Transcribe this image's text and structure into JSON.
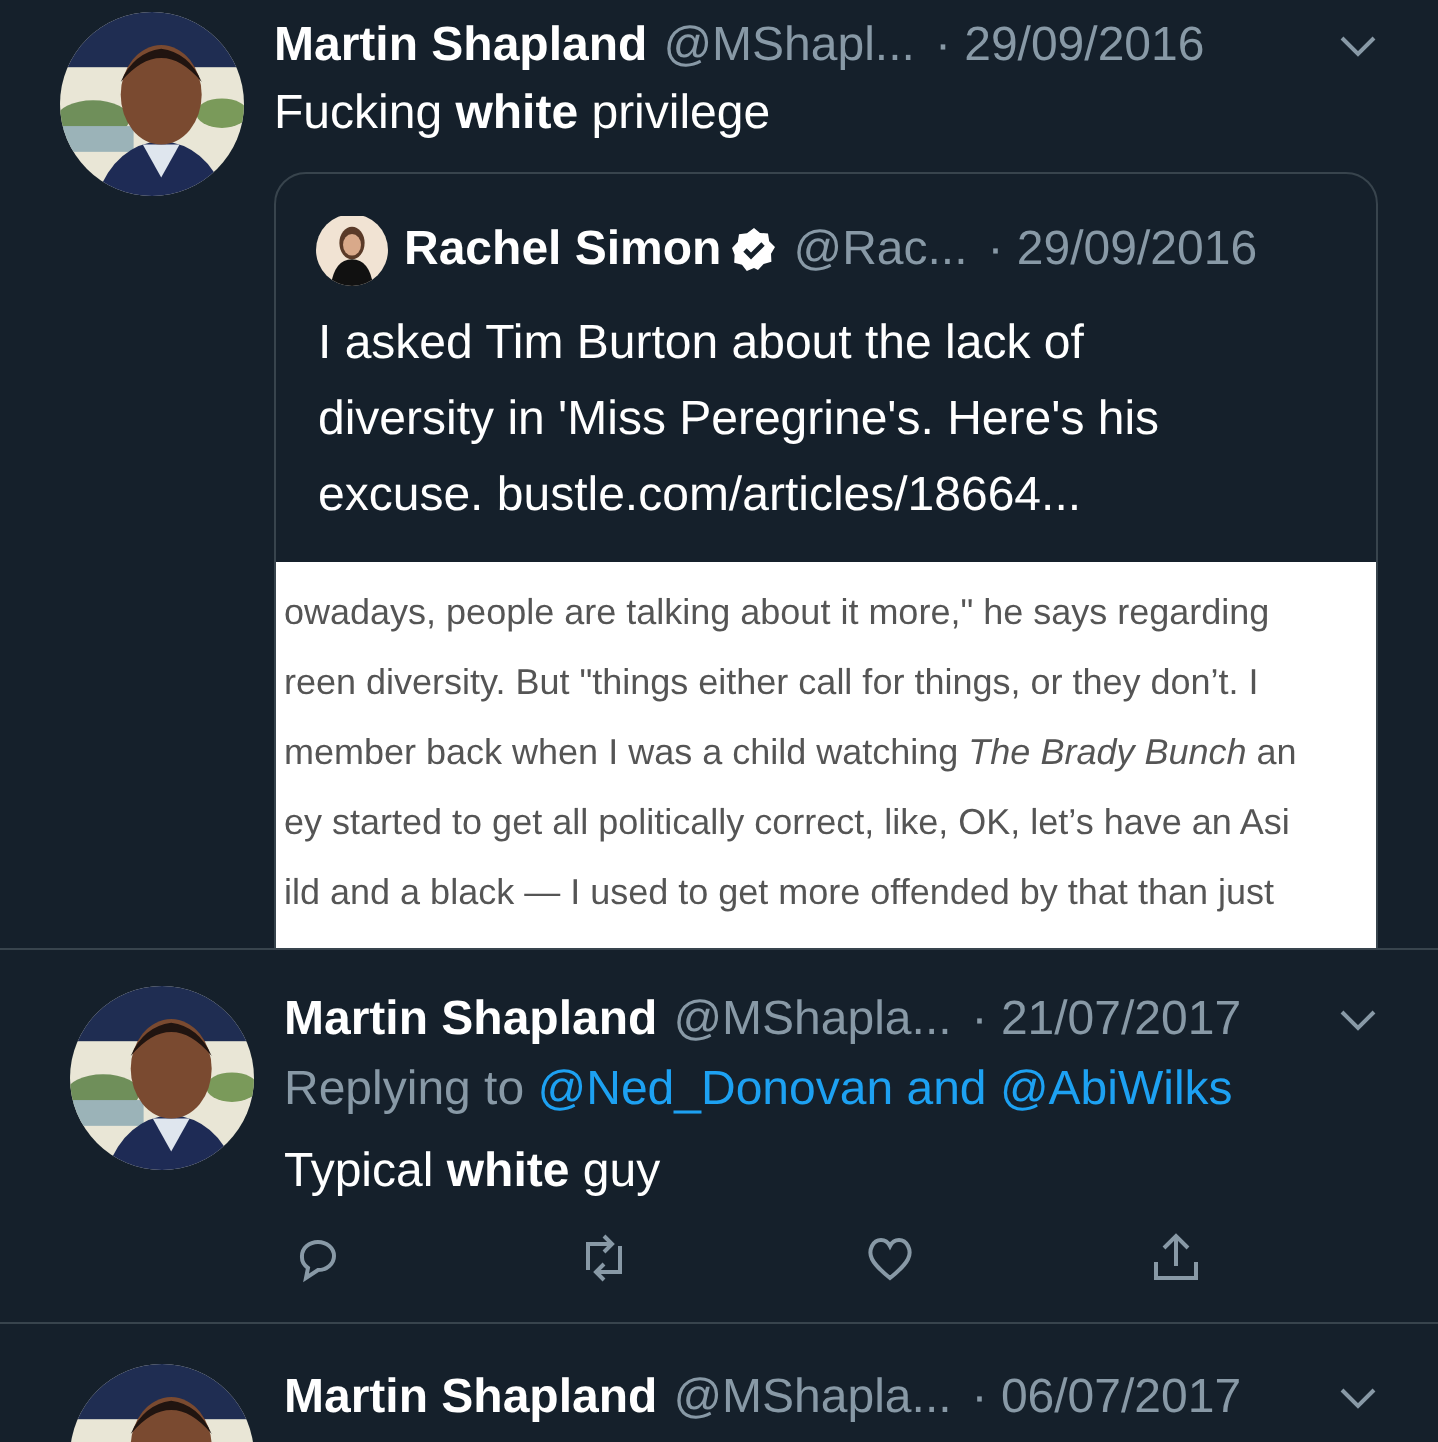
{
  "tweets": [
    {
      "name": "Martin Shapland",
      "handle": "@MShapl...",
      "date": "· 29/09/2016",
      "text": "Fucking **white** privilege",
      "quote": {
        "name": "Rachel Simon",
        "verified": true,
        "handle": "@Rac...",
        "date": "· 29/09/2016",
        "text": "I asked Tim Burton about the lack of diversity in 'Miss Peregrine's. Here's his excuse. bustle.com/articles/18664...",
        "article_lines": [
          "owadays, people are talking about it more,\" he says regarding",
          "reen diversity. But \"things either call for things, or they don’t. I",
          "member back when I was a child watching *The Brady Bunch* an",
          "ey started to get all politically correct, like, OK, let’s have an Asi",
          "ild and a black — I used to get more offended by that than just"
        ]
      }
    },
    {
      "name": "Martin Shapland",
      "handle": "@MShapla...",
      "date": "· 21/07/2017",
      "reply_to": {
        "label": "Replying to",
        "mentions": "@Ned_Donovan and @AbiWilks"
      },
      "text": "Typical **white** guy",
      "actions": true
    },
    {
      "name": "Martin Shapland",
      "handle": "@MShapla...",
      "date": "· 06/07/2017"
    }
  ]
}
